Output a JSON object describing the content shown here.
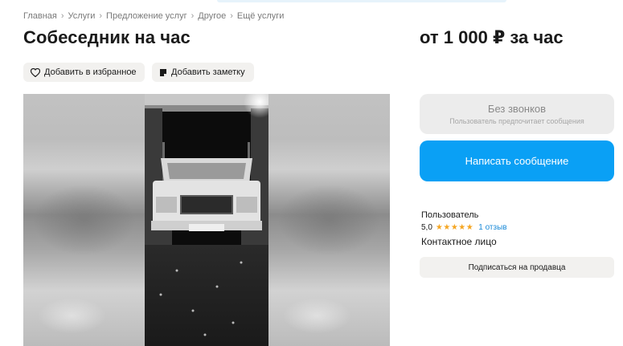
{
  "breadcrumb": [
    "Главная",
    "Услуги",
    "Предложение услуг",
    "Другое",
    "Ещё услуги"
  ],
  "title": "Собеседник на час",
  "price": "от 1 000 ₽ за час",
  "actions": {
    "favorite_label": "Добавить в избранное",
    "note_label": "Добавить заметку"
  },
  "contact_panel": {
    "no_calls_label": "Без звонков",
    "no_calls_sub": "Пользователь предпочитает сообщения",
    "message_button": "Написать сообщение",
    "seller_name": "Пользователь",
    "rating_value": "5,0",
    "rating_stars": 5,
    "reviews_link": "1 отзыв",
    "contact_role": "Контактное лицо",
    "subscribe_button": "Подписаться на продавца"
  },
  "colors": {
    "accent_blue": "#0aa0f5",
    "star": "#f5a623",
    "link": "#1a8ad8"
  }
}
